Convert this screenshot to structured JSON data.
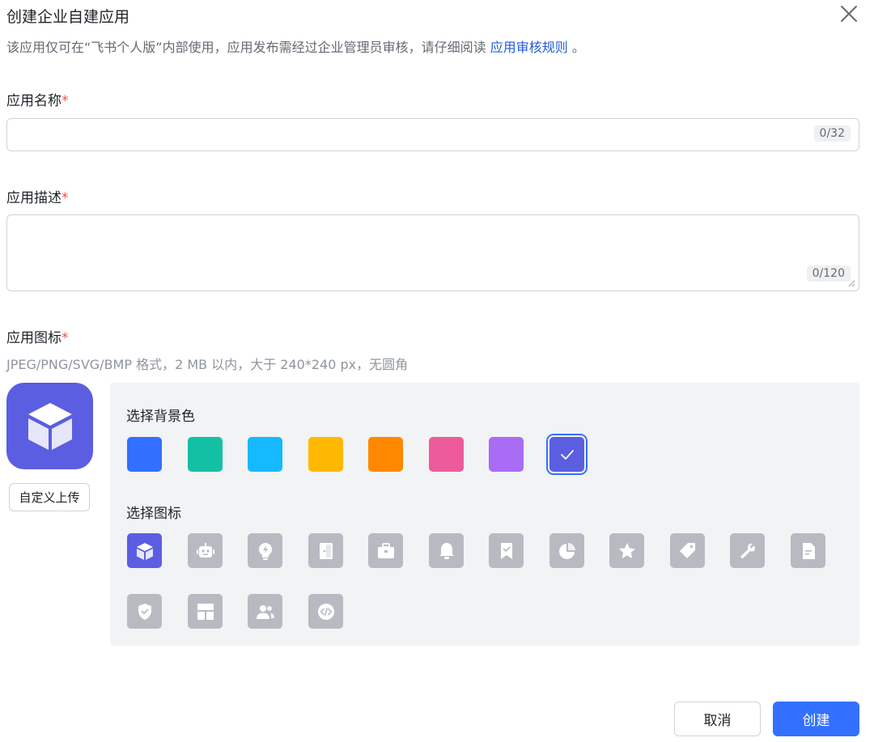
{
  "dialog": {
    "title": "创建企业自建应用",
    "notice_text": "该应用仅可在“飞书个人版”内部使用，应用发布需经过企业管理员审核，请仔细阅读",
    "notice_link": "应用审核规则",
    "notice_end": "。"
  },
  "name_field": {
    "label": "应用名称",
    "required_mark": "*",
    "value": "",
    "counter": "0/32"
  },
  "desc_field": {
    "label": "应用描述",
    "required_mark": "*",
    "value": "",
    "counter": "0/120"
  },
  "icon_section": {
    "label": "应用图标",
    "required_mark": "*",
    "hint": "JPEG/PNG/SVG/BMP 格式，2 MB 以内，大于 240*240 px，无圆角",
    "upload_label": "自定义上传",
    "bg_title": "选择背景色",
    "icon_title": "选择图标",
    "bg_colors": [
      "#3370ff",
      "#14c0a4",
      "#14b9ff",
      "#ffb800",
      "#ff8800",
      "#ed5b9b",
      "#a86cf5",
      "#5b5ee1"
    ],
    "selected_bg": "#5b5ee1",
    "icons": [
      "cube-icon",
      "robot-icon",
      "lightbulb-icon",
      "door-icon",
      "briefcase-icon",
      "bell-icon",
      "bookmark-icon",
      "pie-chart-icon",
      "star-icon",
      "tag-icon",
      "wrench-icon",
      "document-icon",
      "shield-icon",
      "layout-icon",
      "people-icon",
      "code-icon"
    ],
    "selected_icon": "cube-icon",
    "tile_color": "#b7bbc1"
  },
  "footer": {
    "cancel_label": "取消",
    "create_label": "创建"
  }
}
